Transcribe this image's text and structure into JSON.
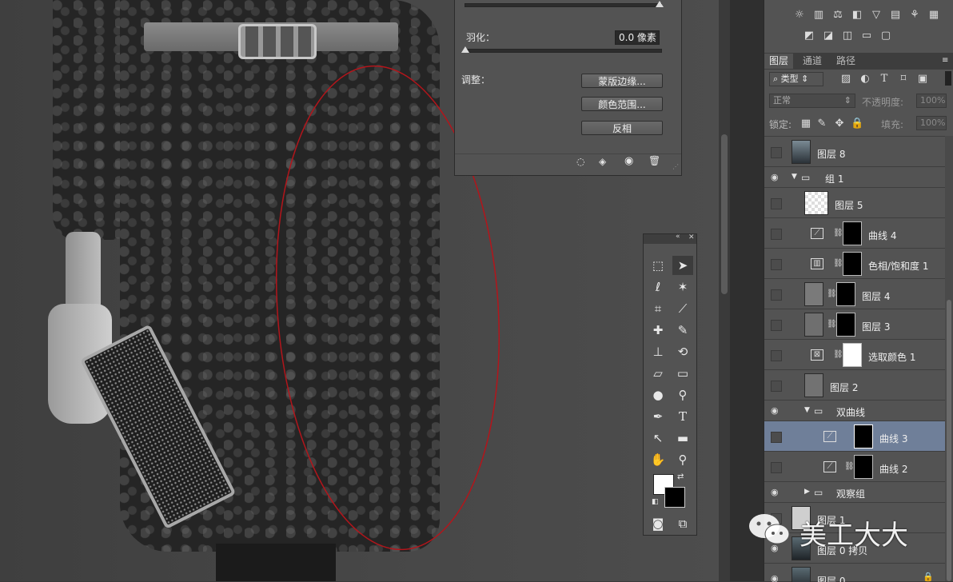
{
  "mask_panel": {
    "feather_label": "羽化：",
    "feather_value": "0.0 像素",
    "adjust_label": "调整：",
    "mask_edge_button": "蒙版边缘...",
    "color_range_button": "颜色范围...",
    "invert_button": "反相"
  },
  "layers_panel": {
    "tabs": [
      "图层",
      "通道",
      "路径"
    ],
    "filter_kind": "类型",
    "blend_mode": "正常",
    "opacity_label": "不透明度:",
    "opacity_value": "100%",
    "lock_label": "锁定:",
    "fill_label": "填充:",
    "fill_value": "100%",
    "layers": [
      {
        "name": "图层 8"
      },
      {
        "name": "组 1"
      },
      {
        "name": "图层 5"
      },
      {
        "name": "曲线 4"
      },
      {
        "name": "色相/饱和度 1"
      },
      {
        "name": "图层 4"
      },
      {
        "name": "图层 3"
      },
      {
        "name": "选取颜色 1"
      },
      {
        "name": "图层 2"
      },
      {
        "name": "双曲线"
      },
      {
        "name": "曲线 3"
      },
      {
        "name": "曲线 2"
      },
      {
        "name": "观察组"
      },
      {
        "name": "图层 1"
      },
      {
        "name": "图层 0 拷贝"
      },
      {
        "name": "图层 0"
      }
    ]
  },
  "watermark": "美工大大",
  "colors": {
    "selected_row": "#6f7f99",
    "annotation_ellipse": "#b3151b",
    "panel_bg": "#535353"
  }
}
